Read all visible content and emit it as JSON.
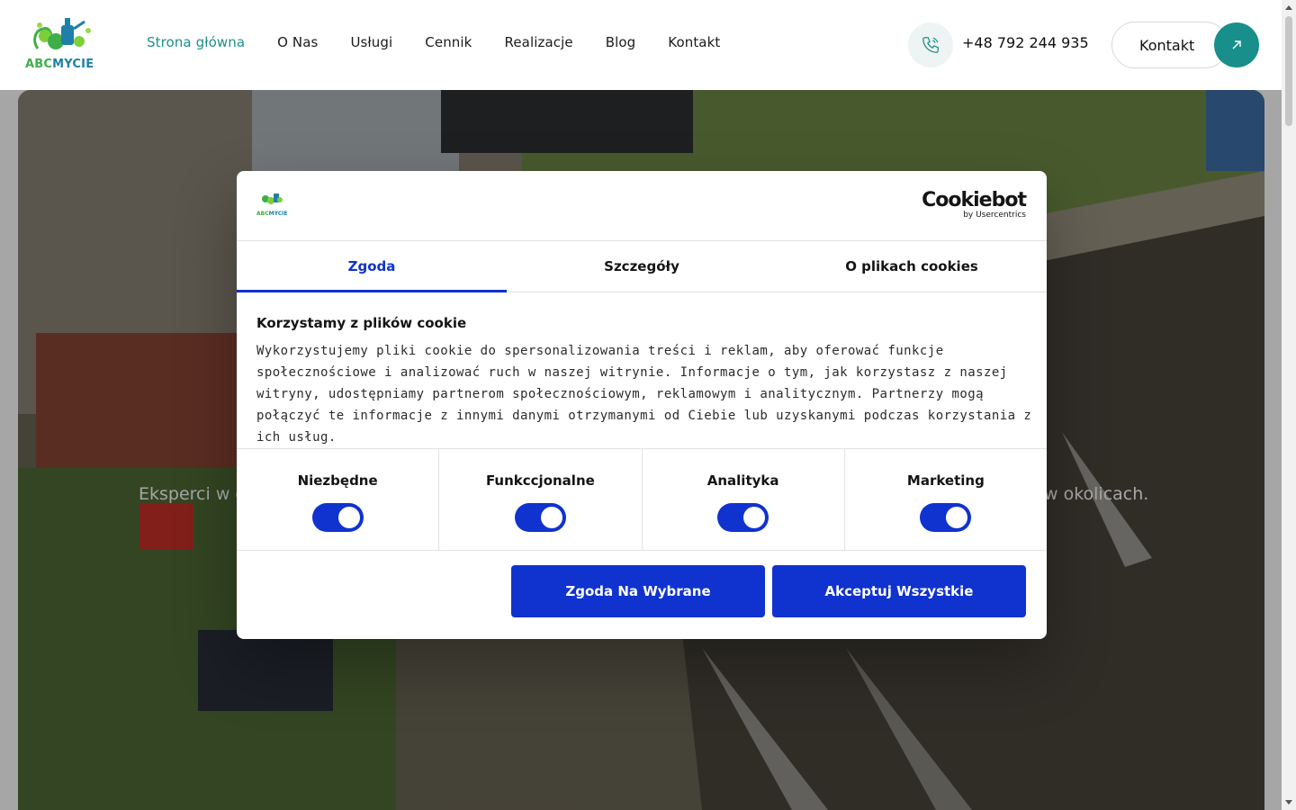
{
  "header": {
    "logo": {
      "part1": "ABC",
      "part2": "MYCIE"
    },
    "nav": [
      {
        "label": "Strona główna",
        "active": true
      },
      {
        "label": "O Nas"
      },
      {
        "label": "Usługi"
      },
      {
        "label": "Cennik"
      },
      {
        "label": "Realizacje"
      },
      {
        "label": "Blog"
      },
      {
        "label": "Kontakt"
      }
    ],
    "phone_icon": "phone-icon",
    "phone": "+48 792 244 935",
    "contact_button": "Kontakt",
    "contact_icon": "arrow-up-right-icon"
  },
  "hero": {
    "subtitle_left": "Eksperci w d",
    "subtitle_right": "w okolicach."
  },
  "cookie": {
    "brand_main": "Cookiebot",
    "brand_sub": "by Usercentrics",
    "site_logo": {
      "part1": "ABC",
      "part2": "MYCIE"
    },
    "tabs": [
      {
        "label": "Zgoda",
        "active": true
      },
      {
        "label": "Szczegóły"
      },
      {
        "label": "O plikach cookies"
      }
    ],
    "heading": "Korzystamy z plików cookie",
    "body": "Wykorzystujemy pliki cookie do spersonalizowania treści i reklam, aby oferować funkcje społecznościowe i analizować ruch w naszej witrynie. Informacje o tym, jak korzystasz z naszej witryny, udostępniamy partnerom społecznościowym, reklamowym i analitycznym. Partnerzy mogą połączyć te informacje z innymi danymi otrzymanymi od Ciebie lub uzyskanymi podczas korzystania z ich usług.",
    "toggles": [
      {
        "label": "Niezbędne",
        "on": true
      },
      {
        "label": "Funkccjonalne",
        "on": true
      },
      {
        "label": "Analityka",
        "on": true
      },
      {
        "label": "Marketing",
        "on": true
      }
    ],
    "btn_selected": "Zgoda Na Wybrane",
    "btn_all": "Akceptuj Wszystkie"
  },
  "colors": {
    "accent_teal": "#188f8a",
    "cookie_blue": "#1032cf",
    "logo_green": "#3fae49",
    "logo_blue": "#1f7fa8"
  }
}
